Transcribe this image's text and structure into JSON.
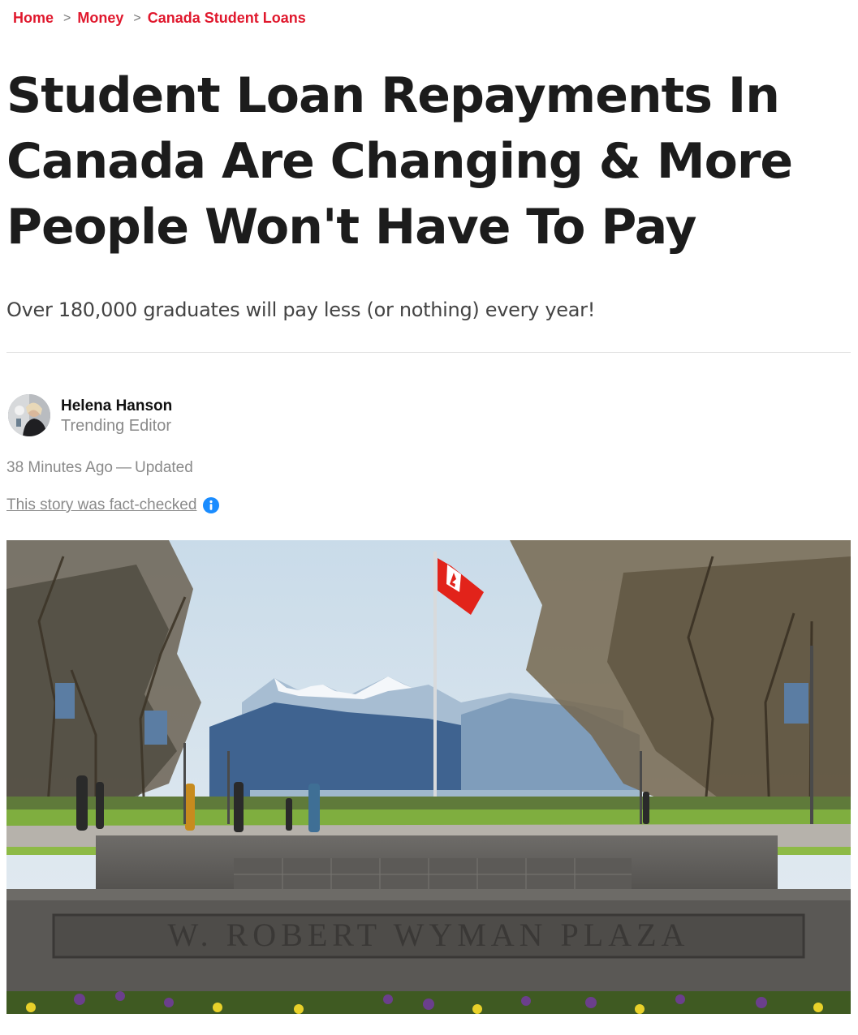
{
  "breadcrumb": {
    "items": [
      {
        "label": "Home"
      },
      {
        "label": "Money"
      },
      {
        "label": "Canada Student Loans"
      }
    ],
    "separator": ">"
  },
  "article": {
    "headline": "Student Loan Repayments In Canada Are Changing & More People Won't Have To Pay",
    "dek": "Over 180,000 graduates will pay less (or nothing) every year!",
    "author": {
      "name": "Helena Hanson",
      "role": "Trending Editor"
    },
    "timestamp": {
      "age": "38 Minutes Ago",
      "dash": "—",
      "status": "Updated"
    },
    "fact_check": {
      "label": "This story was fact-checked",
      "icon": "info-icon"
    },
    "hero_image": {
      "sign_text": "W. ROBERT WYMAN PLAZA"
    }
  },
  "colors": {
    "accent": "#e0182d",
    "info_blue": "#1a8cff",
    "muted": "#8a8a8a"
  }
}
